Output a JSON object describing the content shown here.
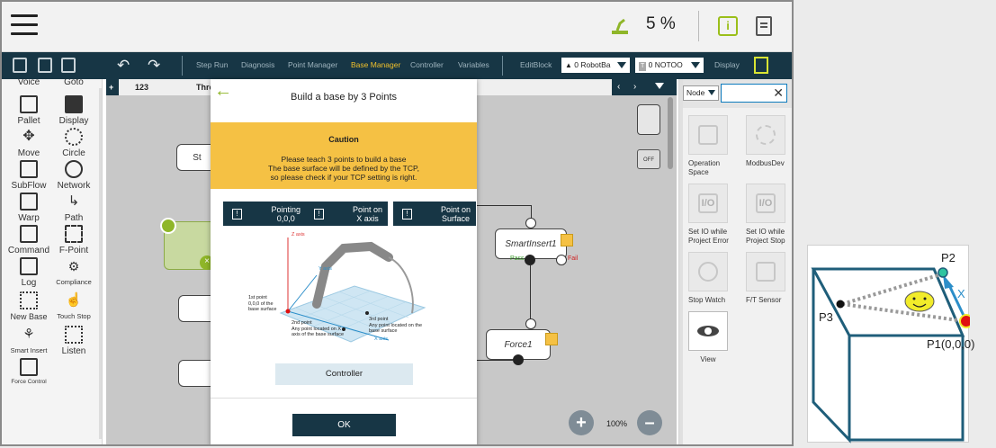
{
  "topbar": {
    "speed": "5 %",
    "icons": [
      "menu-icon",
      "robot-status-icon",
      "info-icon",
      "document-icon"
    ]
  },
  "toolbar": {
    "tabs": [
      "Step Run",
      "Diagnosis",
      "Point Manager",
      "Base Manager",
      "Controller",
      "Variables",
      "EditBlock"
    ],
    "active_tab": "Base Manager",
    "robot_base_select": "0 RobotBa",
    "tool_select": "0 NOTOO",
    "display_label": "Display"
  },
  "left_panel": {
    "items": [
      {
        "label": "Voice",
        "icon": "voice-icon"
      },
      {
        "label": "Goto",
        "icon": "goto-icon"
      },
      {
        "label": "Pallet",
        "icon": "pallet-icon"
      },
      {
        "label": "Display",
        "icon": "display-icon"
      },
      {
        "label": "Move",
        "icon": "move-icon"
      },
      {
        "label": "Circle",
        "icon": "circle-icon"
      },
      {
        "label": "SubFlow",
        "icon": "subflow-icon"
      },
      {
        "label": "Network",
        "icon": "network-icon"
      },
      {
        "label": "Warp",
        "icon": "warp-icon"
      },
      {
        "label": "Path",
        "icon": "path-icon"
      },
      {
        "label": "Command",
        "icon": "command-icon"
      },
      {
        "label": "F-Point",
        "icon": "fpoint-icon"
      },
      {
        "label": "Log",
        "icon": "log-icon"
      },
      {
        "label": "Compliance",
        "icon": "compliance-icon"
      },
      {
        "label": "New Base",
        "icon": "new-base-icon"
      },
      {
        "label": "Touch Stop",
        "icon": "touch-stop-icon"
      },
      {
        "label": "Smart Insert",
        "icon": "smart-insert-icon"
      },
      {
        "label": "Listen",
        "icon": "listen-icon"
      },
      {
        "label": "Force Control",
        "icon": "force-control-icon"
      }
    ]
  },
  "canvas": {
    "tabs": [
      "123",
      "Thre"
    ],
    "nodes": {
      "start_partial": "St",
      "smart_insert": "SmartInsert1",
      "force": "Force1",
      "fail": "Fail",
      "pass": "Pass"
    },
    "zoom": "100%"
  },
  "right_panel": {
    "filter_select": "Node",
    "search_value": "",
    "items": [
      {
        "label": "Operation Space",
        "icon": "operation-space-icon"
      },
      {
        "label": "ModbusDev",
        "icon": "modbus-icon"
      },
      {
        "label": "Set IO while Project Error",
        "icon": "io-error-icon"
      },
      {
        "label": "Set IO while Project Stop",
        "icon": "io-stop-icon"
      },
      {
        "label": "Stop Watch",
        "icon": "stopwatch-icon"
      },
      {
        "label": "F/T Sensor",
        "icon": "ft-sensor-icon"
      },
      {
        "label": "View",
        "icon": "view-icon"
      }
    ]
  },
  "modal": {
    "title": "Build a base by 3 Points",
    "caution_title": "Caution",
    "caution_lines": [
      "Please teach 3 points to build a base",
      "The base surface will be defined by the TCP,",
      "so please check if your TCP setting is right."
    ],
    "steps": [
      {
        "line1": "Pointing",
        "line2": "0,0,0"
      },
      {
        "line1": "Point on",
        "line2": "X axis"
      },
      {
        "line1": "Point on",
        "line2": "Surface"
      }
    ],
    "diagram": {
      "z_axis": "Z axis",
      "y_axis": "Y axis",
      "x_axis": "X axis",
      "p1": [
        "1st point",
        "0,0,0 of the",
        "base surface"
      ],
      "p2": [
        "2nd  point",
        "Any point located on X",
        "axis of the base surface"
      ],
      "p3": [
        "3rd  point",
        "Any point located on the",
        "base surface"
      ]
    },
    "controller_button": "Controller",
    "ok_button": "OK"
  },
  "inset": {
    "p1": "P1(0,0,0)",
    "p2": "P2",
    "p3": "P3",
    "x": "X",
    "colors": {
      "p1": "#e01010",
      "p2": "#2ec4a0",
      "x_arrow": "#2b8ec9"
    }
  }
}
